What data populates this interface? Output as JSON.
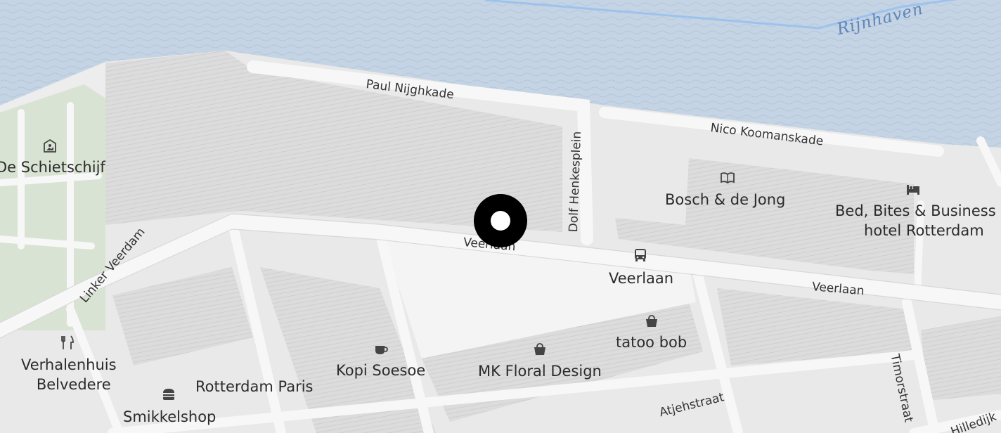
{
  "map": {
    "water_label": "Rijnhaven",
    "streets": {
      "paul_nijghkade": "Paul Nijghkade",
      "nico_koomanskade": "Nico Koomanskade",
      "dolf_henkesplein": "Dolf Henkesplein",
      "veerlaan_west": "Veerlaan",
      "veerlaan_east": "Veerlaan",
      "linker_veerdam": "Linker Veerdam",
      "atjehstraat": "Atjehstraat",
      "timorstraat": "Timorstraat",
      "hilledijk": "Hilledijk"
    },
    "pois": {
      "de_schietschijf": {
        "name": "De Schietschijf",
        "icon": "museum-icon"
      },
      "bosch_de_jong": {
        "name": "Bosch & de Jong",
        "icon": "book-icon"
      },
      "bed_bites": {
        "line1": "Bed, Bites & Business",
        "line2": "hotel Rotterdam",
        "icon": "bed-icon"
      },
      "veerlaan_stop": {
        "name": "Veerlaan",
        "icon": "bus-icon"
      },
      "tatoo_bob": {
        "name": "tatoo bob",
        "icon": "shopping-bag-icon"
      },
      "mk_floral": {
        "name": "MK Floral Design",
        "icon": "shopping-bag-icon"
      },
      "kopi_soesoe": {
        "name": "Kopi Soesoe",
        "icon": "coffee-cup-icon"
      },
      "verhalenhuis": {
        "line1": "Verhalenhuis",
        "line2": "Belvedere",
        "icon": "fork-knife-icon"
      },
      "rotterdam_paris": {
        "name": "Rotterdam Paris"
      },
      "smikkelshop": {
        "name": "Smikkelshop",
        "icon": "burger-icon"
      }
    },
    "marker": {
      "icon": "location-marker"
    },
    "colors": {
      "water": "#c4d4e4",
      "land": "#ededed",
      "park": "#d9e3d3",
      "road": "#fafafa",
      "building": "#dadada",
      "ferry_line": "#9ec2ee",
      "marker": "#000000"
    }
  }
}
